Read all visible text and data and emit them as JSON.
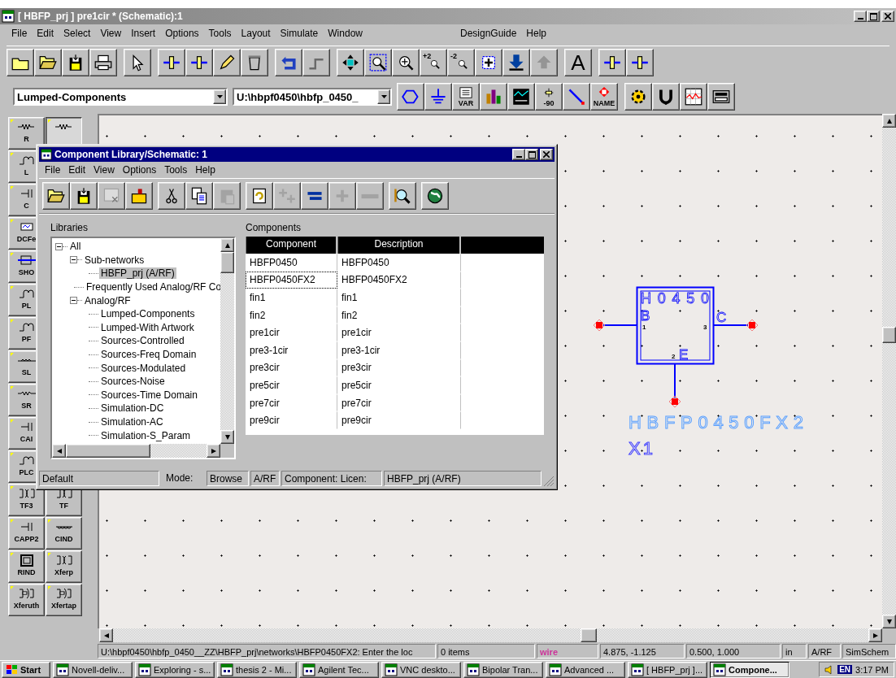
{
  "window": {
    "title": "[ HBFP_prj ] pre1cir * (Schematic):1",
    "active": false
  },
  "menu": {
    "items": [
      "File",
      "Edit",
      "Select",
      "View",
      "Insert",
      "Options",
      "Tools",
      "Layout",
      "Simulate",
      "Window"
    ],
    "extra": [
      "DesignGuide",
      "Help"
    ]
  },
  "toolbar": {
    "buttons": [
      {
        "disabled": false
      },
      {
        "disabled": false
      },
      {
        "disabled": false
      },
      {
        "disabled": false
      },
      {
        "disabled": false
      },
      {
        "disabled": false
      },
      {
        "disabled": false
      },
      {
        "disabled": false
      },
      {
        "disabled": false
      },
      {
        "disabled": false
      },
      {
        "disabled": true
      },
      {
        "disabled": false
      },
      {
        "disabled": false
      },
      {
        "disabled": false
      },
      {
        "disabled": false,
        "text": "+2"
      },
      {
        "disabled": false,
        "text": "-2"
      },
      {
        "disabled": false
      },
      {
        "disabled": false
      },
      {
        "disabled": true
      },
      {
        "disabled": false,
        "text": "A"
      },
      {
        "disabled": false
      },
      {
        "disabled": false
      }
    ]
  },
  "toolbar2": {
    "library": "Lumped-Components",
    "path": "U:\\hbpf0450\\hbfp_0450_",
    "buttons": [
      {
        "disabled": false
      },
      {
        "disabled": false
      },
      {
        "disabled": false,
        "text": "VAR"
      },
      {
        "disabled": false
      },
      {
        "disabled": false
      },
      {
        "disabled": false,
        "text": "-90"
      },
      {
        "disabled": false
      },
      {
        "disabled": false,
        "text": "NAME"
      },
      {
        "disabled": false
      },
      {
        "disabled": false
      },
      {
        "disabled": false
      },
      {
        "disabled": false
      }
    ]
  },
  "palette": {
    "rows": [
      [
        {
          "label": "R",
          "selected": false
        },
        {
          "selected": true
        }
      ],
      [
        {
          "label": "L",
          "selected": false
        }
      ],
      [
        {
          "label": "C",
          "selected": false
        }
      ],
      [
        {
          "label": "DCFe",
          "selected": false
        }
      ],
      [
        {
          "label": "SHO",
          "selected": false
        }
      ],
      [
        {
          "label": "PL",
          "selected": false
        }
      ],
      [
        {
          "label": "PF",
          "selected": false
        }
      ],
      [
        {
          "label": "SL",
          "selected": false
        }
      ],
      [
        {
          "label": "SR",
          "selected": false
        }
      ],
      [
        {
          "label": "CAI",
          "selected": false
        }
      ],
      [
        {
          "label": "PLC",
          "selected": false
        }
      ],
      [
        {
          "label": "TF3",
          "selected": false
        },
        {
          "label": "TF",
          "selected": false
        }
      ],
      [
        {
          "label": "CAPP2",
          "selected": false
        },
        {
          "label": "CIND",
          "selected": false
        }
      ],
      [
        {
          "label": "RIND",
          "selected": false
        },
        {
          "label": "Xferp",
          "selected": false
        }
      ],
      [
        {
          "label": "Xferuth",
          "selected": false
        },
        {
          "label": "Xfertap",
          "selected": false
        }
      ]
    ]
  },
  "schematic": {
    "symbol_name": "H0450",
    "pins": [
      {
        "label": "B",
        "number": "1"
      },
      {
        "label": "C",
        "number": "3"
      },
      {
        "label": "E",
        "number": "2"
      }
    ],
    "instance_type": "HBFP0450FX2",
    "instance_name": "X1"
  },
  "dialog": {
    "title": "Component Library/Schematic: 1",
    "active": true,
    "menu": [
      "File",
      "Edit",
      "View",
      "Options",
      "Tools",
      "Help"
    ],
    "toolbar": [
      {
        "disabled": false
      },
      {
        "disabled": false
      },
      {
        "disabled": true
      },
      {
        "disabled": false
      },
      {
        "disabled": false
      },
      {
        "disabled": false
      },
      {
        "disabled": true
      },
      {
        "disabled": false
      },
      {
        "disabled": true
      },
      {
        "disabled": false
      },
      {
        "disabled": true
      },
      {
        "disabled": true
      },
      {
        "disabled": false
      },
      {
        "disabled": false
      }
    ],
    "libraries_label": "Libraries",
    "tree": [
      {
        "label": "All",
        "expanded": true,
        "selected": false,
        "children": [
          {
            "label": "Sub-networks",
            "expanded": true,
            "selected": false,
            "children": [
              {
                "label": "HBFP_prj (A/RF)",
                "selected": true
              }
            ]
          },
          {
            "label": "Frequently Used Analog/RF Co",
            "selected": false
          },
          {
            "label": "Analog/RF",
            "expanded": true,
            "selected": false,
            "children": [
              {
                "label": "Lumped-Components",
                "selected": false
              },
              {
                "label": "Lumped-With Artwork",
                "selected": false
              },
              {
                "label": "Sources-Controlled",
                "selected": false
              },
              {
                "label": "Sources-Freq Domain",
                "selected": false
              },
              {
                "label": "Sources-Modulated",
                "selected": false
              },
              {
                "label": "Sources-Noise",
                "selected": false
              },
              {
                "label": "Sources-Time Domain",
                "selected": false
              },
              {
                "label": "Simulation-DC",
                "selected": false
              },
              {
                "label": "Simulation-AC",
                "selected": false
              },
              {
                "label": "Simulation-S_Param",
                "selected": false
              }
            ]
          }
        ]
      }
    ],
    "components_label": "Components",
    "table": {
      "columns": [
        "Component",
        "Description"
      ],
      "rows": [
        {
          "cells": [
            "HBFP0450",
            "HBFP0450"
          ],
          "selected": false
        },
        {
          "cells": [
            "HBFP0450FX2",
            "HBFP0450FX2"
          ],
          "selected": true
        },
        {
          "cells": [
            "fin1",
            "fin1"
          ],
          "selected": false
        },
        {
          "cells": [
            "fin2",
            "fin2"
          ],
          "selected": false
        },
        {
          "cells": [
            "pre1cir",
            "pre1cir"
          ],
          "selected": false
        },
        {
          "cells": [
            "pre3-1cir",
            "pre3-1cir"
          ],
          "selected": false
        },
        {
          "cells": [
            "pre3cir",
            "pre3cir"
          ],
          "selected": false
        },
        {
          "cells": [
            "pre5cir",
            "pre5cir"
          ],
          "selected": false
        },
        {
          "cells": [
            "pre7cir",
            "pre7cir"
          ],
          "selected": false
        },
        {
          "cells": [
            "pre9cir",
            "pre9cir"
          ],
          "selected": false
        }
      ]
    },
    "status_bar": [
      "Default",
      "Mode:",
      "Browse",
      "A/RF",
      "Component: Licen:",
      "HBFP_prj (A/RF)"
    ]
  },
  "status_bar": [
    {
      "text": "U:\\hbpf0450\\hbfp_0450__ZZ\\HBFP_prj\\networks\\HBFP0450FX2: Enter the loc"
    },
    {
      "text": "0 items"
    },
    {
      "text": "wire",
      "color": "#cc3399"
    },
    {
      "text": "4.875, -1.125"
    },
    {
      "text": "0.500, 1.000"
    },
    {
      "text": "in"
    },
    {
      "text": "A/RF"
    },
    {
      "text": "SimSchem"
    }
  ],
  "taskbar": {
    "start": "Start",
    "items": [
      {
        "label": "Novell-deliv...",
        "selected": false
      },
      {
        "label": "Exploring - s...",
        "selected": false
      },
      {
        "label": "thesis 2 - Mi...",
        "selected": false
      },
      {
        "label": "Agilent Tec...",
        "selected": false
      },
      {
        "label": "VNC deskto...",
        "selected": false
      },
      {
        "label": "Bipolar Tran...",
        "selected": false
      },
      {
        "label": "Advanced ...",
        "selected": false
      },
      {
        "label": "[ HBFP_prj ]...",
        "selected": false
      },
      {
        "label": "Compone...",
        "selected": true
      }
    ],
    "language": "EN",
    "clock": "3:17 PM"
  }
}
